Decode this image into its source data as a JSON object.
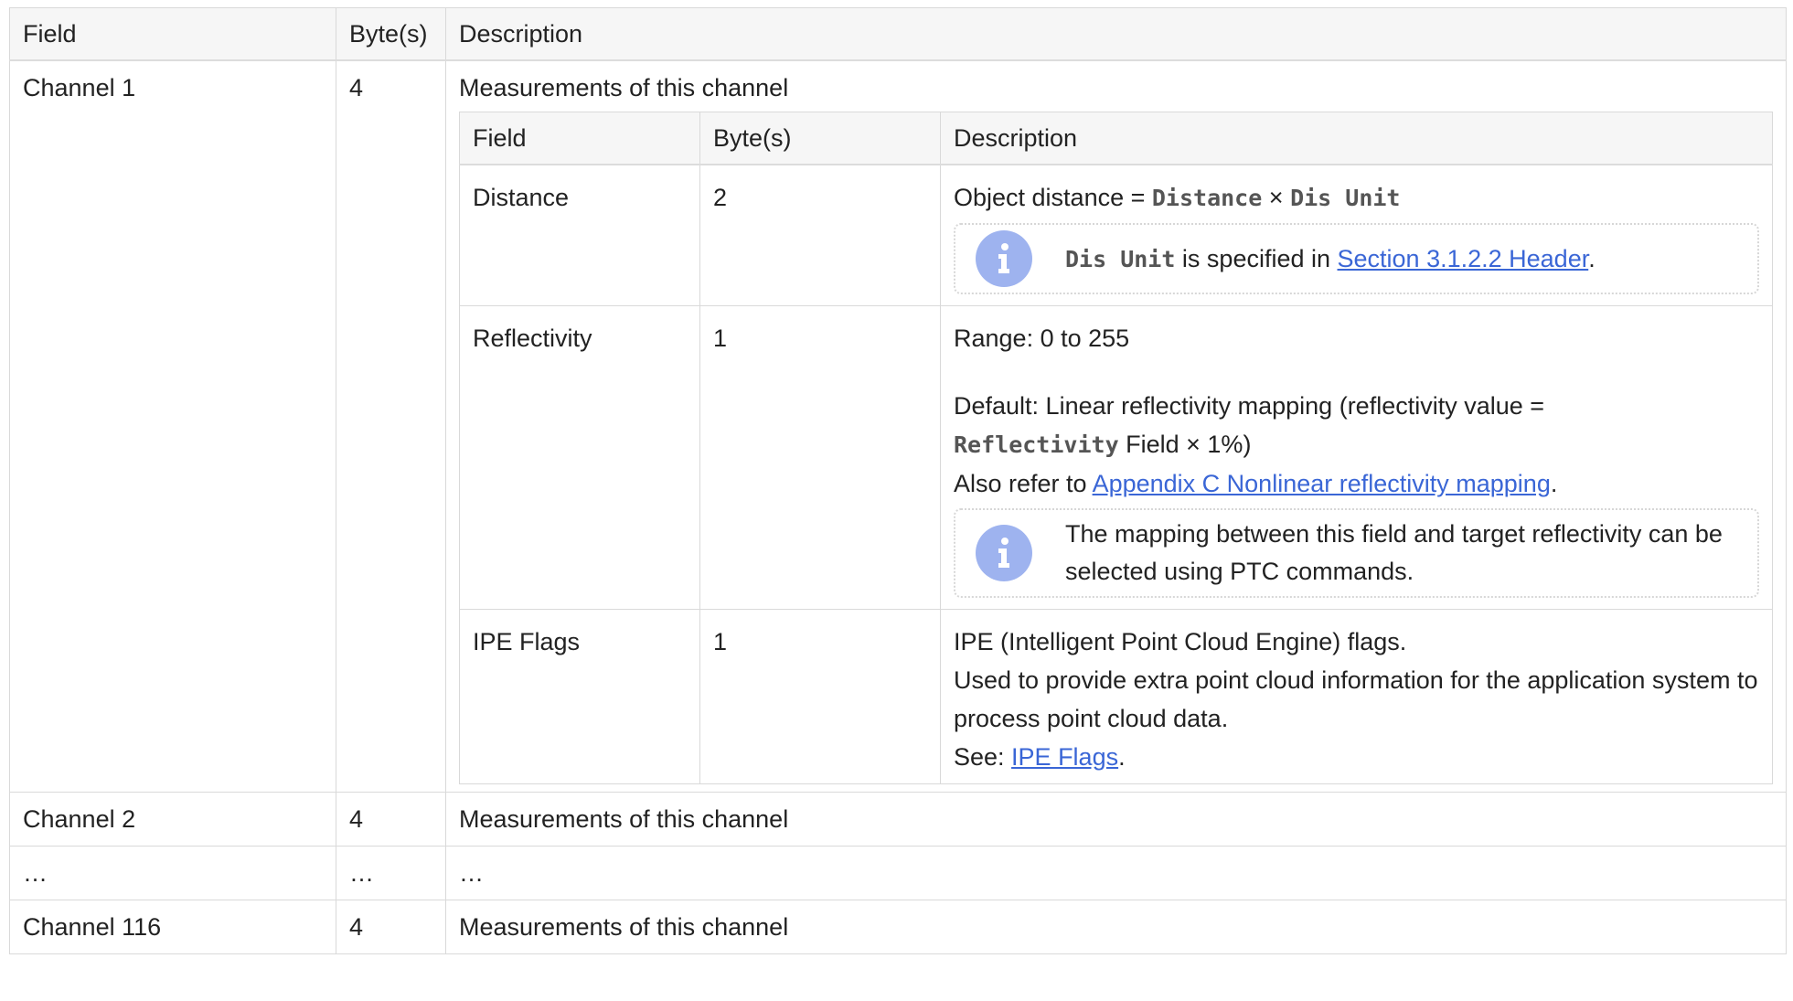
{
  "outer": {
    "headers": [
      "Field",
      "Byte(s)",
      "Description"
    ],
    "ch1": {
      "field": "Channel 1",
      "bytes": "4",
      "desc": "Measurements of this channel"
    },
    "rows": [
      {
        "field": "Channel 2",
        "bytes": "4",
        "desc": "Measurements of this channel"
      },
      {
        "field": "…",
        "bytes": "…",
        "desc": "…"
      },
      {
        "field": "Channel 116",
        "bytes": "4",
        "desc": "Measurements of this channel"
      }
    ]
  },
  "inner": {
    "headers": [
      "Field",
      "Byte(s)",
      "Description"
    ],
    "distance": {
      "field": "Distance",
      "bytes": "2",
      "desc_prefix": "Object distance = ",
      "code1": "Distance",
      "times": " × ",
      "code2": "Dis Unit",
      "note_code": "Dis Unit",
      "note_text": " is specified in ",
      "note_link": "Section 3.1.2.2 Header",
      "note_end": "."
    },
    "reflectivity": {
      "field": "Reflectivity",
      "bytes": "1",
      "range": "Range: 0 to 255",
      "default_line": "Default: Linear reflectivity mapping (reflectivity value =",
      "code": "Reflectivity",
      "field_suffix": " Field × 1%)",
      "refer_prefix": "Also refer to ",
      "refer_link": "Appendix C Nonlinear reflectivity mapping",
      "refer_end": ".",
      "note": "The mapping between this field and target reflectivity can be selected using PTC commands."
    },
    "ipe": {
      "field": "IPE Flags",
      "bytes": "1",
      "line1": "IPE (Intelligent Point Cloud Engine) flags.",
      "line2": "Used to provide extra point cloud information for the application system to process point cloud data.",
      "see_prefix": "See: ",
      "see_link": "IPE Flags",
      "see_end": "."
    }
  },
  "icons": {
    "info": "info-icon",
    "info_color": "#9eb3ef",
    "link_color": "#3a66d6"
  }
}
